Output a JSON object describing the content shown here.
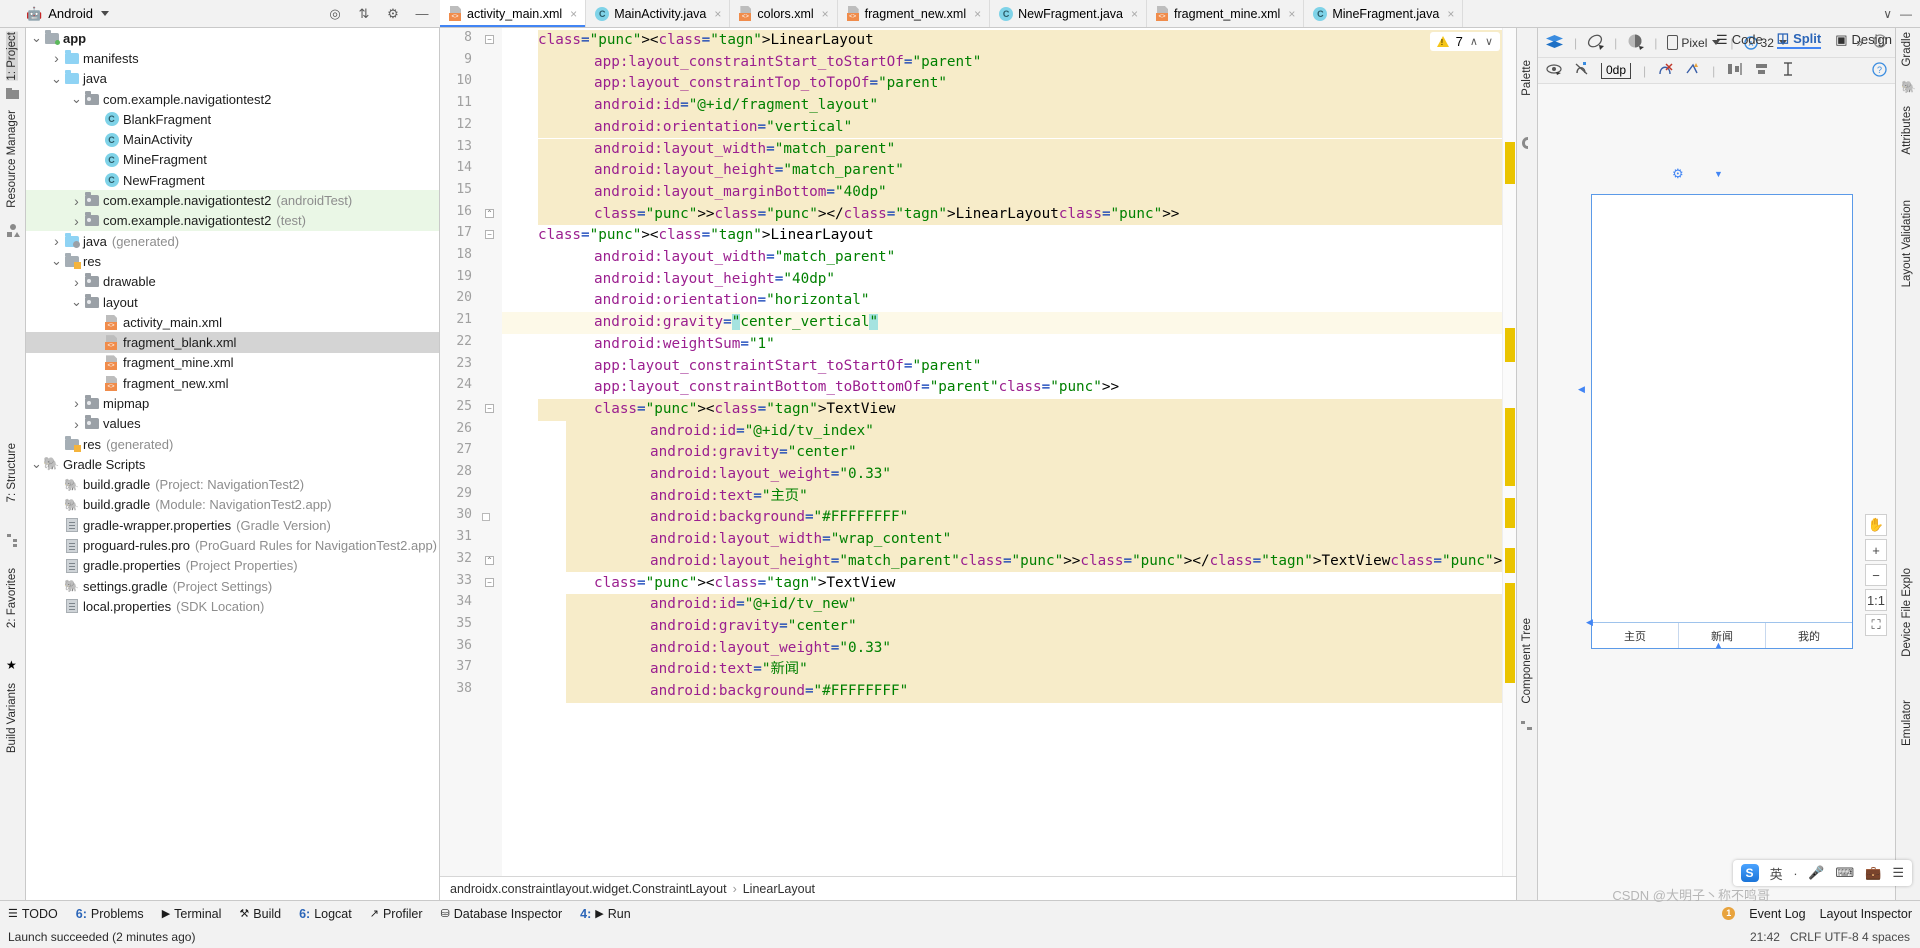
{
  "project": {
    "selector_label": "Android",
    "tree": [
      {
        "depth": 0,
        "arrow": "v",
        "icon": "module-folder",
        "label": "app",
        "bold": true,
        "sub": "",
        "state": "normal"
      },
      {
        "depth": 1,
        "arrow": ">",
        "icon": "folder-blue",
        "label": "manifests",
        "sub": "",
        "state": "normal"
      },
      {
        "depth": 1,
        "arrow": "v",
        "icon": "folder-blue",
        "label": "java",
        "sub": "",
        "state": "normal"
      },
      {
        "depth": 2,
        "arrow": "v",
        "icon": "folder-gray",
        "label": "com.example.navigationtest2",
        "sub": "",
        "state": "normal"
      },
      {
        "depth": 3,
        "arrow": "",
        "icon": "class",
        "label": "BlankFragment",
        "sub": "",
        "state": "normal"
      },
      {
        "depth": 3,
        "arrow": "",
        "icon": "class",
        "label": "MainActivity",
        "sub": "",
        "state": "normal"
      },
      {
        "depth": 3,
        "arrow": "",
        "icon": "class",
        "label": "MineFragment",
        "sub": "",
        "state": "normal"
      },
      {
        "depth": 3,
        "arrow": "",
        "icon": "class",
        "label": "NewFragment",
        "sub": "",
        "state": "normal"
      },
      {
        "depth": 2,
        "arrow": ">",
        "icon": "folder-gray",
        "label": "com.example.navigationtest2",
        "sub": "(androidTest)",
        "state": "green"
      },
      {
        "depth": 2,
        "arrow": ">",
        "icon": "folder-gray",
        "label": "com.example.navigationtest2",
        "sub": "(test)",
        "state": "green"
      },
      {
        "depth": 1,
        "arrow": ">",
        "icon": "folder-gen",
        "label": "java",
        "sub": "(generated)",
        "state": "normal"
      },
      {
        "depth": 1,
        "arrow": "v",
        "icon": "folder-res",
        "label": "res",
        "sub": "",
        "state": "normal"
      },
      {
        "depth": 2,
        "arrow": ">",
        "icon": "folder-gray",
        "label": "drawable",
        "sub": "",
        "state": "normal"
      },
      {
        "depth": 2,
        "arrow": "v",
        "icon": "folder-gray",
        "label": "layout",
        "sub": "",
        "state": "normal"
      },
      {
        "depth": 3,
        "arrow": "",
        "icon": "xml",
        "label": "activity_main.xml",
        "sub": "",
        "state": "normal"
      },
      {
        "depth": 3,
        "arrow": "",
        "icon": "xml",
        "label": "fragment_blank.xml",
        "sub": "",
        "state": "selected"
      },
      {
        "depth": 3,
        "arrow": "",
        "icon": "xml",
        "label": "fragment_mine.xml",
        "sub": "",
        "state": "normal"
      },
      {
        "depth": 3,
        "arrow": "",
        "icon": "xml",
        "label": "fragment_new.xml",
        "sub": "",
        "state": "normal"
      },
      {
        "depth": 2,
        "arrow": ">",
        "icon": "folder-gray",
        "label": "mipmap",
        "sub": "",
        "state": "normal"
      },
      {
        "depth": 2,
        "arrow": ">",
        "icon": "folder-gray",
        "label": "values",
        "sub": "",
        "state": "normal"
      },
      {
        "depth": 1,
        "arrow": "",
        "icon": "folder-res",
        "label": "res",
        "sub": "(generated)",
        "state": "normal"
      },
      {
        "depth": 0,
        "arrow": "v",
        "icon": "gradle",
        "label": "Gradle Scripts",
        "sub": "",
        "state": "normal"
      },
      {
        "depth": 1,
        "arrow": "",
        "icon": "gradle-file",
        "label": "build.gradle",
        "sub": "(Project: NavigationTest2)",
        "state": "normal"
      },
      {
        "depth": 1,
        "arrow": "",
        "icon": "gradle-file",
        "label": "build.gradle",
        "sub": "(Module: NavigationTest2.app)",
        "state": "normal"
      },
      {
        "depth": 1,
        "arrow": "",
        "icon": "props",
        "label": "gradle-wrapper.properties",
        "sub": "(Gradle Version)",
        "state": "normal"
      },
      {
        "depth": 1,
        "arrow": "",
        "icon": "props",
        "label": "proguard-rules.pro",
        "sub": "(ProGuard Rules for NavigationTest2.app)",
        "state": "normal"
      },
      {
        "depth": 1,
        "arrow": "",
        "icon": "props",
        "label": "gradle.properties",
        "sub": "(Project Properties)",
        "state": "normal"
      },
      {
        "depth": 1,
        "arrow": "",
        "icon": "gradle-file",
        "label": "settings.gradle",
        "sub": "(Project Settings)",
        "state": "normal"
      },
      {
        "depth": 1,
        "arrow": "",
        "icon": "props",
        "label": "local.properties",
        "sub": "(SDK Location)",
        "state": "normal"
      }
    ]
  },
  "left_rail": {
    "project_label": "1: Project",
    "resource_manager_label": "Resource Manager",
    "structure_label": "7: Structure",
    "favorites_label": "2: Favorites",
    "build_variants_label": "Build Variants"
  },
  "right_rail": {
    "gradle_label": "Gradle",
    "attributes_label": "Attributes",
    "layout_validation_label": "Layout Validation",
    "device_file_explorer_label": "Device File Explo",
    "emulator_label": "Emulator"
  },
  "tabs": [
    {
      "label": "activity_main.xml",
      "icon": "xml",
      "active": true
    },
    {
      "label": "MainActivity.java",
      "icon": "java",
      "active": false
    },
    {
      "label": "colors.xml",
      "icon": "xml",
      "active": false
    },
    {
      "label": "fragment_new.xml",
      "icon": "xml",
      "active": false
    },
    {
      "label": "NewFragment.java",
      "icon": "java",
      "active": false
    },
    {
      "label": "fragment_mine.xml",
      "icon": "xml",
      "active": false
    },
    {
      "label": "MineFragment.java",
      "icon": "java",
      "active": false
    }
  ],
  "view_modes": {
    "code": "Code",
    "split": "Split",
    "design": "Design",
    "active": "Split"
  },
  "inspections": {
    "warning_count": "7"
  },
  "editor": {
    "first_line": 8,
    "lines": [
      {
        "n": 8,
        "indent": 2,
        "text": "<LinearLayout",
        "hl": "yellow-start",
        "fold": "-"
      },
      {
        "n": 9,
        "indent": 4,
        "text": "app:layout_constraintStart_toStartOf=\"parent\"",
        "hl": "yellow"
      },
      {
        "n": 10,
        "indent": 4,
        "text": "app:layout_constraintTop_toTopOf=\"parent\"",
        "hl": "yellow"
      },
      {
        "n": 11,
        "indent": 4,
        "text": "android:id=\"@+id/fragment_layout\"",
        "hl": "yellow"
      },
      {
        "n": 12,
        "indent": 4,
        "text": "android:orientation=\"vertical\"",
        "hl": "yellow"
      },
      {
        "n": 13,
        "indent": 4,
        "text": "android:layout_width=\"match_parent\"",
        "hl": "yellow"
      },
      {
        "n": 14,
        "indent": 4,
        "text": "android:layout_height=\"match_parent\"",
        "hl": "yellow"
      },
      {
        "n": 15,
        "indent": 4,
        "text": "android:layout_marginBottom=\"40dp\"",
        "hl": "yellow"
      },
      {
        "n": 16,
        "indent": 4,
        "text": "></LinearLayout>",
        "hl": "yellow-end",
        "fold": "^"
      },
      {
        "n": 17,
        "indent": 2,
        "text": "<LinearLayout",
        "hl": "none",
        "fold": "-"
      },
      {
        "n": 18,
        "indent": 4,
        "text": "android:layout_width=\"match_parent\"",
        "hl": "none"
      },
      {
        "n": 19,
        "indent": 4,
        "text": "android:layout_height=\"40dp\"",
        "hl": "none"
      },
      {
        "n": 20,
        "indent": 4,
        "text": "android:orientation=\"horizontal\"",
        "hl": "none"
      },
      {
        "n": 21,
        "indent": 4,
        "text": "android:gravity=\"center_vertical\"",
        "hl": "caret",
        "selected": true
      },
      {
        "n": 22,
        "indent": 4,
        "text": "android:weightSum=\"1\"",
        "hl": "none"
      },
      {
        "n": 23,
        "indent": 4,
        "text": "app:layout_constraintStart_toStartOf=\"parent\"",
        "hl": "none"
      },
      {
        "n": 24,
        "indent": 4,
        "text": "app:layout_constraintBottom_toBottomOf=\"parent\">",
        "hl": "none"
      },
      {
        "n": 25,
        "indent": 4,
        "text": "<TextView",
        "hl": "yellow-start",
        "fold": "-"
      },
      {
        "n": 26,
        "indent": 6,
        "text": "android:id=\"@+id/tv_index\"",
        "hl": "yellow"
      },
      {
        "n": 27,
        "indent": 6,
        "text": "android:gravity=\"center\"",
        "hl": "yellow"
      },
      {
        "n": 28,
        "indent": 6,
        "text": "android:layout_weight=\"0.33\"",
        "hl": "yellow"
      },
      {
        "n": 29,
        "indent": 6,
        "text": "android:text=\"主页\"",
        "hl": "yellow"
      },
      {
        "n": 30,
        "indent": 6,
        "text": "android:background=\"#FFFFFFFF\"",
        "hl": "yellow",
        "swatch": "#FFFFFF"
      },
      {
        "n": 31,
        "indent": 6,
        "text": "android:layout_width=\"wrap_content\"",
        "hl": "yellow"
      },
      {
        "n": 32,
        "indent": 6,
        "text": "android:layout_height=\"match_parent\"></TextView>",
        "hl": "yellow-end",
        "fold": "^"
      },
      {
        "n": 33,
        "indent": 4,
        "text": "<TextView",
        "hl": "none",
        "fold": "-"
      },
      {
        "n": 34,
        "indent": 6,
        "text": "android:id=\"@+id/tv_new\"",
        "hl": "yellow"
      },
      {
        "n": 35,
        "indent": 6,
        "text": "android:gravity=\"center\"",
        "hl": "yellow"
      },
      {
        "n": 36,
        "indent": 6,
        "text": "android:layout_weight=\"0.33\"",
        "hl": "yellow"
      },
      {
        "n": 37,
        "indent": 6,
        "text": "android:text=\"新闻\"",
        "hl": "yellow"
      },
      {
        "n": 38,
        "indent": 6,
        "text": "android:background=\"#FFFFFFFF\"",
        "hl": "yellow"
      }
    ]
  },
  "breadcrumb": {
    "root": "androidx.constraintlayout.widget.ConstraintLayout",
    "sep": "›",
    "leaf": "LinearLayout"
  },
  "design_panel": {
    "palette_label": "Palette",
    "component_tree_label": "Component Tree",
    "device_label": "Pixel",
    "api_label": "32",
    "margin_value": "0dp",
    "zoom_reset": "1:1",
    "zoom_in": "+",
    "zoom_out": "−",
    "nav_items": [
      "主页",
      "新闻",
      "我的"
    ]
  },
  "bottom_tools": [
    {
      "label": "TODO",
      "icon": "list-icon",
      "num": ""
    },
    {
      "label": "Problems",
      "icon": "",
      "num": "6:"
    },
    {
      "label": "Terminal",
      "icon": "terminal-icon",
      "num": ""
    },
    {
      "label": "Build",
      "icon": "hammer-icon",
      "num": ""
    },
    {
      "label": "Logcat",
      "icon": "",
      "num": "6:"
    },
    {
      "label": "Profiler",
      "icon": "profiler-icon",
      "num": ""
    },
    {
      "label": "Database Inspector",
      "icon": "db-icon",
      "num": ""
    },
    {
      "label": "Run",
      "icon": "play-icon",
      "num": "4:"
    }
  ],
  "bottom_right": {
    "event_log": "Event Log",
    "layout_inspector": "Layout Inspector",
    "badge": "1"
  },
  "status": {
    "message": "Launch succeeded (2 minutes ago)",
    "time": "21:42",
    "encoding": "CRLF  UTF-8  4 spaces",
    "watermark": "CSDN @大明子丶称不鸣哥"
  },
  "ime": {
    "lang": "英",
    "dot": "∙",
    "mic": "mic-icon",
    "keyboard": "keyboard-icon",
    "toolbox": "toolbox-icon",
    "menu": "menu-icon",
    "logo": "S"
  },
  "colors": {
    "accent": "#4285f4",
    "warning": "#f5c518",
    "highlight": "#f7ecc9",
    "selection": "#d4d4d4",
    "green_row": "#eaf7e6"
  }
}
